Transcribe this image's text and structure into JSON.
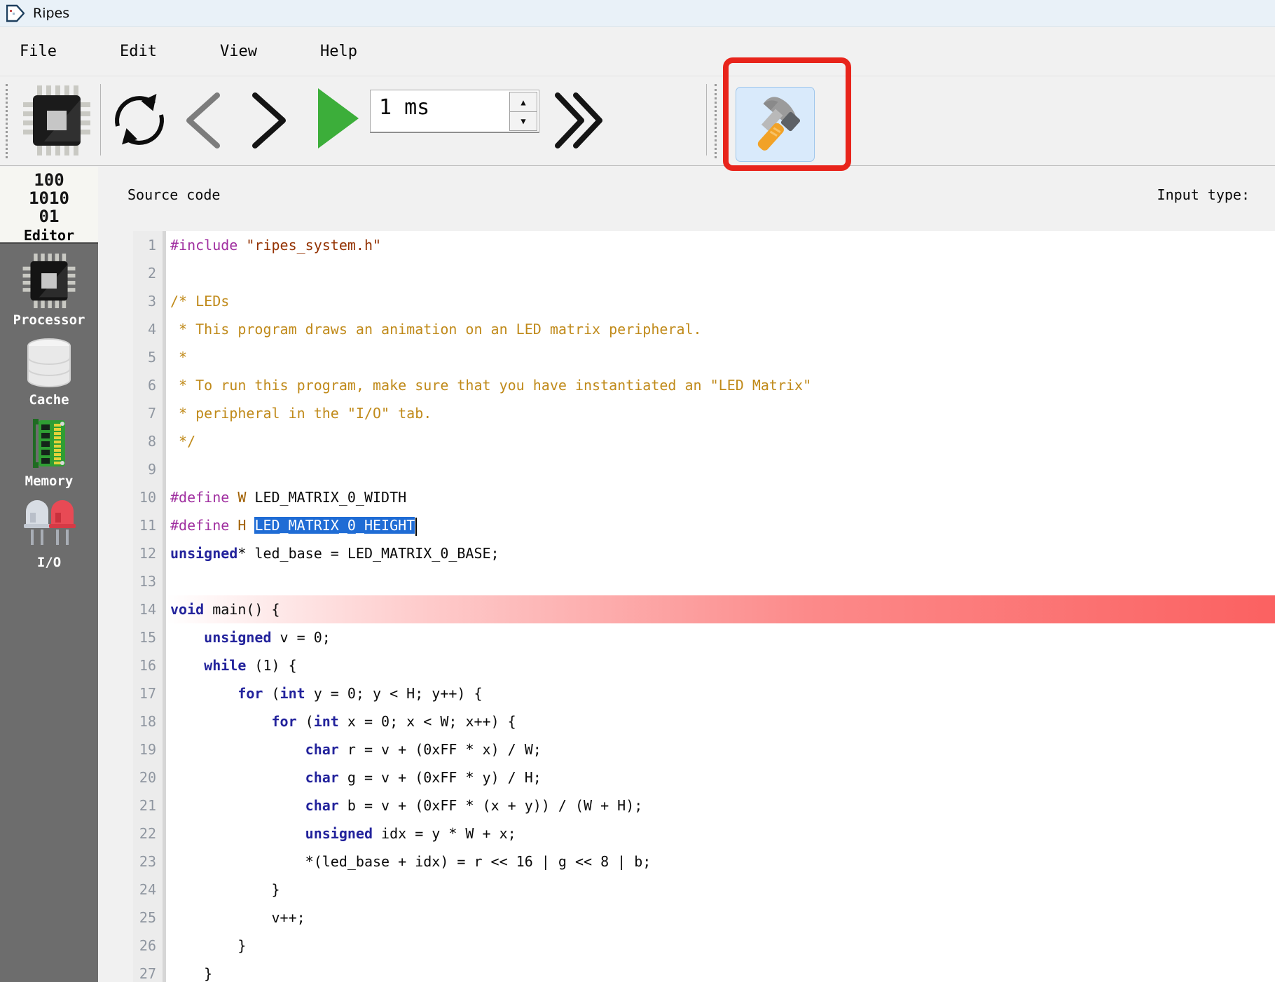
{
  "window": {
    "title": "Ripes"
  },
  "menu": {
    "items": [
      {
        "label": "File"
      },
      {
        "label": "Edit"
      },
      {
        "label": "View"
      },
      {
        "label": "Help"
      }
    ]
  },
  "toolbar": {
    "buttons": [
      {
        "name": "select-processor",
        "icon": "processor-chip-icon"
      },
      {
        "name": "reset",
        "icon": "circular-arrows-icon"
      },
      {
        "name": "step-back",
        "icon": "chevron-left-icon",
        "state": "disabled"
      },
      {
        "name": "step-forward",
        "icon": "chevron-right-icon"
      },
      {
        "name": "run",
        "icon": "green-play-icon"
      },
      {
        "name": "fast-forward",
        "icon": "double-chevron-icon"
      },
      {
        "name": "build",
        "icon": "hammer-icon",
        "state": "highlighted-by-red-annotation"
      }
    ],
    "speed_spinbox": {
      "value": "1 ms"
    },
    "annotation_color": "#e8241b",
    "build_button_bg": "#d9eafb"
  },
  "sidebar": {
    "editor_icon_lines": [
      "100",
      "1010",
      "01"
    ],
    "items": [
      {
        "label": "Editor",
        "selected": true
      },
      {
        "label": "Processor",
        "selected": false
      },
      {
        "label": "Cache",
        "selected": false
      },
      {
        "label": "Memory",
        "selected": false
      },
      {
        "label": "I/O",
        "selected": false
      }
    ],
    "dark_bg": "#6d6d6d"
  },
  "source_panel": {
    "title": "Source code",
    "input_type_label": "Input type:"
  },
  "editor": {
    "colors": {
      "keyword": "#23239c",
      "preprocessor": "#a02fa0",
      "macro": "#a05f00",
      "string": "#933100",
      "comment": "#c08a1a",
      "selection_bg": "#1f6cd5",
      "exec_line": "#f91e1e"
    },
    "lines": [
      {
        "no": 1,
        "segments": [
          [
            "p",
            "#include"
          ],
          [
            "t",
            " "
          ],
          [
            "s",
            "\"ripes_system.h\""
          ]
        ]
      },
      {
        "no": 2,
        "segments": []
      },
      {
        "no": 3,
        "segments": [
          [
            "c",
            "/* LEDs"
          ]
        ]
      },
      {
        "no": 4,
        "segments": [
          [
            "c",
            " * This program draws an animation on an LED matrix peripheral."
          ]
        ]
      },
      {
        "no": 5,
        "segments": [
          [
            "c",
            " *"
          ]
        ]
      },
      {
        "no": 6,
        "segments": [
          [
            "c",
            " * To run this program, make sure that you have instantiated an \"LED Matrix\""
          ]
        ]
      },
      {
        "no": 7,
        "segments": [
          [
            "c",
            " * peripheral in the \"I/O\" tab."
          ]
        ]
      },
      {
        "no": 8,
        "segments": [
          [
            "c",
            " */"
          ]
        ]
      },
      {
        "no": 9,
        "segments": []
      },
      {
        "no": 10,
        "segments": [
          [
            "p",
            "#define"
          ],
          [
            "t",
            " "
          ],
          [
            "m",
            "W"
          ],
          [
            "t",
            " LED_MATRIX_0_WIDTH"
          ]
        ]
      },
      {
        "no": 11,
        "cursor": true,
        "segments": [
          [
            "p",
            "#define"
          ],
          [
            "t",
            " "
          ],
          [
            "m",
            "H"
          ],
          [
            "t",
            " "
          ],
          [
            "sel",
            "LED_MATRIX_0_HEIGHT"
          ]
        ]
      },
      {
        "no": 12,
        "segments": [
          [
            "k",
            "unsigned"
          ],
          [
            "t",
            "* led_base = LED_MATRIX_0_BASE;"
          ]
        ]
      },
      {
        "no": 13,
        "segments": []
      },
      {
        "no": 14,
        "highlight": "exec",
        "segments": [
          [
            "k",
            "void"
          ],
          [
            "t",
            " main() {"
          ]
        ]
      },
      {
        "no": 15,
        "segments": [
          [
            "t",
            "    "
          ],
          [
            "k",
            "unsigned"
          ],
          [
            "t",
            " v = 0;"
          ]
        ]
      },
      {
        "no": 16,
        "segments": [
          [
            "t",
            "    "
          ],
          [
            "k",
            "while"
          ],
          [
            "t",
            " (1) {"
          ]
        ]
      },
      {
        "no": 17,
        "segments": [
          [
            "t",
            "        "
          ],
          [
            "k",
            "for"
          ],
          [
            "t",
            " ("
          ],
          [
            "k",
            "int"
          ],
          [
            "t",
            " y = 0; y < H; y++) {"
          ]
        ]
      },
      {
        "no": 18,
        "segments": [
          [
            "t",
            "            "
          ],
          [
            "k",
            "for"
          ],
          [
            "t",
            " ("
          ],
          [
            "k",
            "int"
          ],
          [
            "t",
            " x = 0; x < W; x++) {"
          ]
        ]
      },
      {
        "no": 19,
        "segments": [
          [
            "t",
            "                "
          ],
          [
            "k",
            "char"
          ],
          [
            "t",
            " r = v + (0xFF * x) / W;"
          ]
        ]
      },
      {
        "no": 20,
        "segments": [
          [
            "t",
            "                "
          ],
          [
            "k",
            "char"
          ],
          [
            "t",
            " g = v + (0xFF * y) / H;"
          ]
        ]
      },
      {
        "no": 21,
        "segments": [
          [
            "t",
            "                "
          ],
          [
            "k",
            "char"
          ],
          [
            "t",
            " b = v + (0xFF * (x + y)) / (W + H);"
          ]
        ]
      },
      {
        "no": 22,
        "segments": [
          [
            "t",
            "                "
          ],
          [
            "k",
            "unsigned"
          ],
          [
            "t",
            " idx = y * W + x;"
          ]
        ]
      },
      {
        "no": 23,
        "segments": [
          [
            "t",
            "                *(led_base + idx) = r << 16 | g << 8 | b;"
          ]
        ]
      },
      {
        "no": 24,
        "segments": [
          [
            "t",
            "            }"
          ]
        ]
      },
      {
        "no": 25,
        "segments": [
          [
            "t",
            "            v++;"
          ]
        ]
      },
      {
        "no": 26,
        "segments": [
          [
            "t",
            "        }"
          ]
        ]
      },
      {
        "no": 27,
        "segments": [
          [
            "t",
            "    }"
          ]
        ]
      }
    ]
  }
}
